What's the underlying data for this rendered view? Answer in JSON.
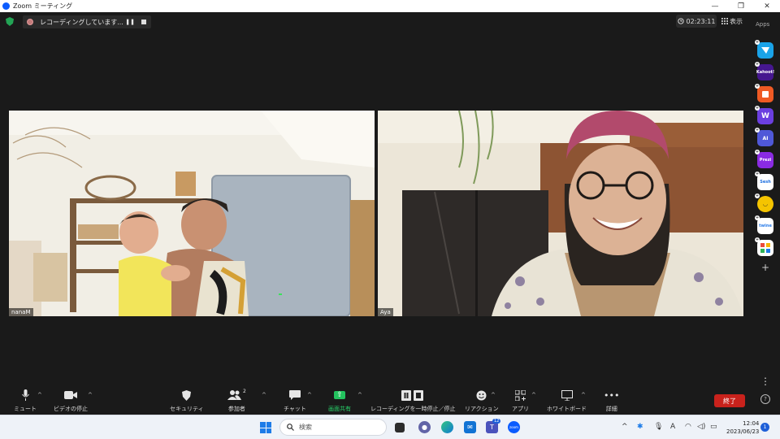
{
  "window": {
    "title": "Zoom ミーティング",
    "controls": {
      "minimize": "—",
      "maximize": "❐",
      "close": "✕"
    }
  },
  "topbar": {
    "recording_text": "レコーディングしています...",
    "pause_glyph": "❚❚",
    "timer": "02:23:11",
    "view_label": "表示",
    "apps_label": "Apps"
  },
  "participants": [
    {
      "name": "nanaM"
    },
    {
      "name": "Aya"
    }
  ],
  "apps": [
    {
      "name": "app-1",
      "label": "",
      "color": "#1aa3e8"
    },
    {
      "name": "kahoot",
      "label": "Kahoot!",
      "color": "#46178f"
    },
    {
      "name": "app-3",
      "label": "",
      "color": "#ef5a24"
    },
    {
      "name": "app-w",
      "label": "W",
      "color": "#6b3fe0"
    },
    {
      "name": "app-ai",
      "label": "AI",
      "color": "#4f58d8"
    },
    {
      "name": "prezi",
      "label": "Prezi",
      "color": "#8a2be2"
    },
    {
      "name": "sesh",
      "label": "Sesh",
      "color": "#ffffff"
    },
    {
      "name": "app-face",
      "label": "",
      "color": "#f5c400"
    },
    {
      "name": "twine",
      "label": "twine",
      "color": "#ffffff"
    },
    {
      "name": "app-grid",
      "label": "",
      "color": "#ffffff"
    }
  ],
  "toolbar": {
    "mute": "ミュート",
    "video": "ビデオの停止",
    "security": "セキュリティ",
    "participants": "参加者",
    "participants_count": "2",
    "chat": "チャット",
    "share": "画面共有",
    "recording": "レコーディングを一時停止／停止",
    "reactions": "リアクション",
    "apps": "アプリ",
    "whiteboard": "ホワイトボード",
    "more": "詳細",
    "end": "終了",
    "help": "?"
  },
  "taskbar": {
    "search_placeholder": "検索",
    "teams_badge": "12",
    "zoom_label": "zoom",
    "time": "12:04",
    "date": "2023/06/23",
    "notifications": "1"
  }
}
